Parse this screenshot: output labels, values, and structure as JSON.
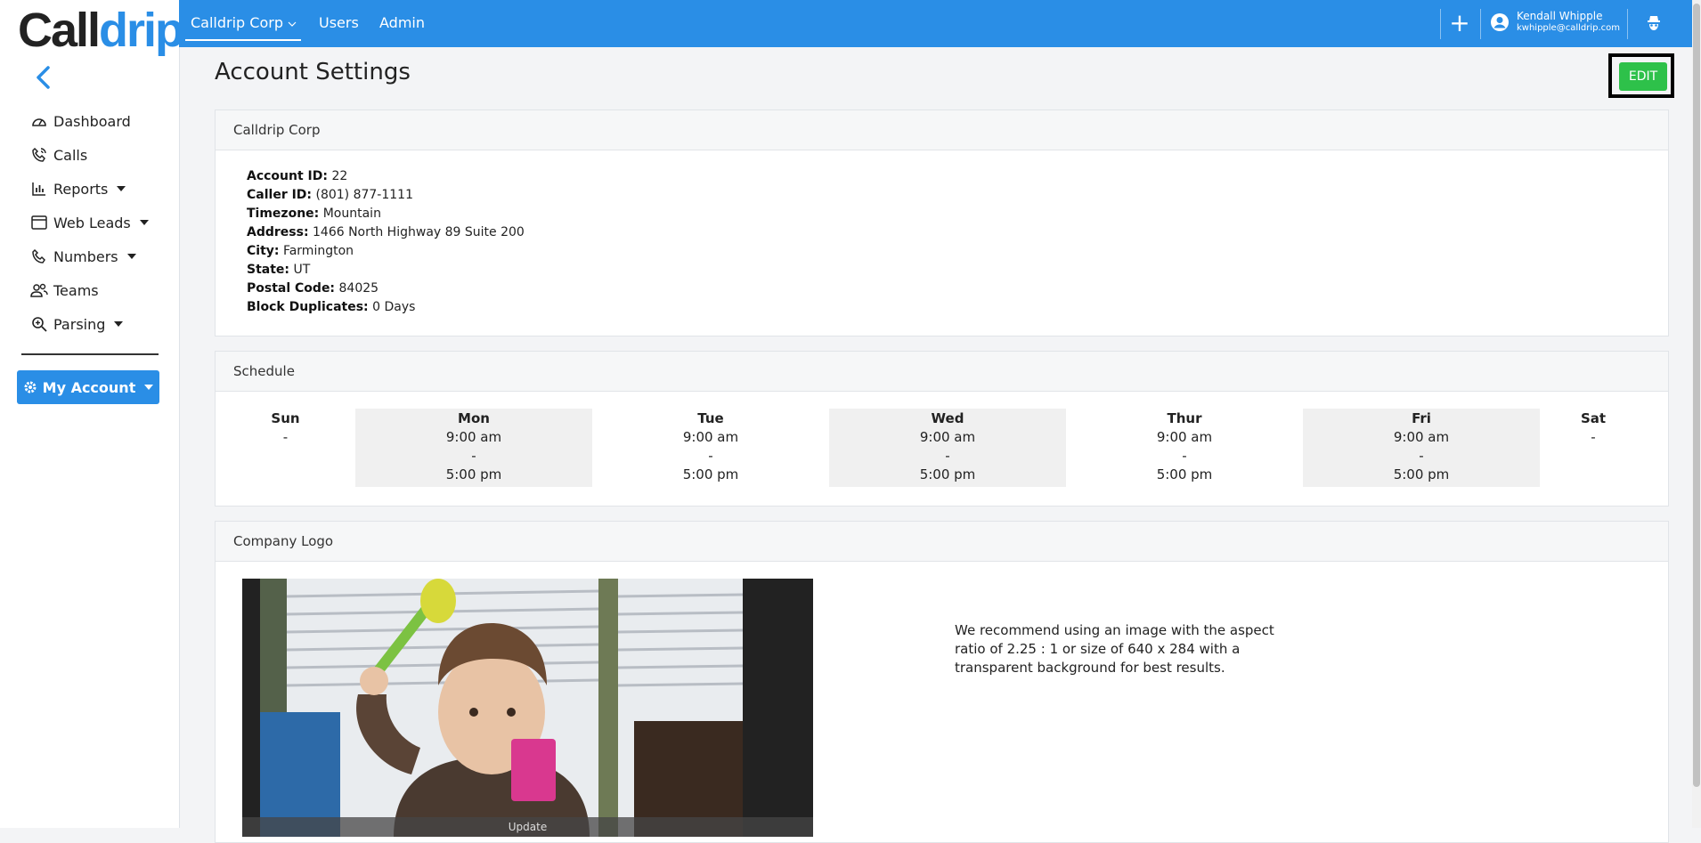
{
  "brand": {
    "part1": "Call",
    "part2": "drip"
  },
  "sidebar": {
    "items": [
      {
        "label": "Dashboard"
      },
      {
        "label": "Calls"
      },
      {
        "label": "Reports"
      },
      {
        "label": "Web Leads"
      },
      {
        "label": "Numbers"
      },
      {
        "label": "Teams"
      },
      {
        "label": "Parsing"
      }
    ],
    "my_account": "My Account"
  },
  "topbar": {
    "tabs": [
      {
        "label": "Calldrip Corp"
      },
      {
        "label": "Users"
      },
      {
        "label": "Admin"
      }
    ],
    "plus": "+",
    "user_name": "Kendall Whipple",
    "user_email": "kwhipple@calldrip.com"
  },
  "page": {
    "title": "Account Settings",
    "edit_label": "EDIT"
  },
  "account": {
    "card_title": "Calldrip Corp",
    "fields": [
      {
        "label": "Account ID:",
        "value": "22"
      },
      {
        "label": "Caller ID:",
        "value": "(801) 877-1111"
      },
      {
        "label": "Timezone:",
        "value": "Mountain"
      },
      {
        "label": "Address:",
        "value": "1466 North Highway 89 Suite 200"
      },
      {
        "label": "City:",
        "value": "Farmington"
      },
      {
        "label": "State:",
        "value": "UT"
      },
      {
        "label": "Postal Code:",
        "value": "84025"
      },
      {
        "label": "Block Duplicates:",
        "value": "0 Days"
      }
    ]
  },
  "schedule": {
    "card_title": "Schedule",
    "days": [
      {
        "name": "Sun",
        "open": "",
        "sep": "-",
        "close": ""
      },
      {
        "name": "Mon",
        "open": "9:00 am",
        "sep": "-",
        "close": "5:00 pm"
      },
      {
        "name": "Tue",
        "open": "9:00 am",
        "sep": "-",
        "close": "5:00 pm"
      },
      {
        "name": "Wed",
        "open": "9:00 am",
        "sep": "-",
        "close": "5:00 pm"
      },
      {
        "name": "Thur",
        "open": "9:00 am",
        "sep": "-",
        "close": "5:00 pm"
      },
      {
        "name": "Fri",
        "open": "9:00 am",
        "sep": "-",
        "close": "5:00 pm"
      },
      {
        "name": "Sat",
        "open": "",
        "sep": "-",
        "close": ""
      }
    ]
  },
  "company_logo": {
    "card_title": "Company Logo",
    "update_label": "Update",
    "recommendation": "We recommend using an image with the aspect ratio of 2.25 : 1 or size of 640 x 284 with a transparent background for best results."
  },
  "colors": {
    "primary": "#2a8ee6",
    "success": "#2ec14a",
    "background": "#f3f4f6"
  }
}
